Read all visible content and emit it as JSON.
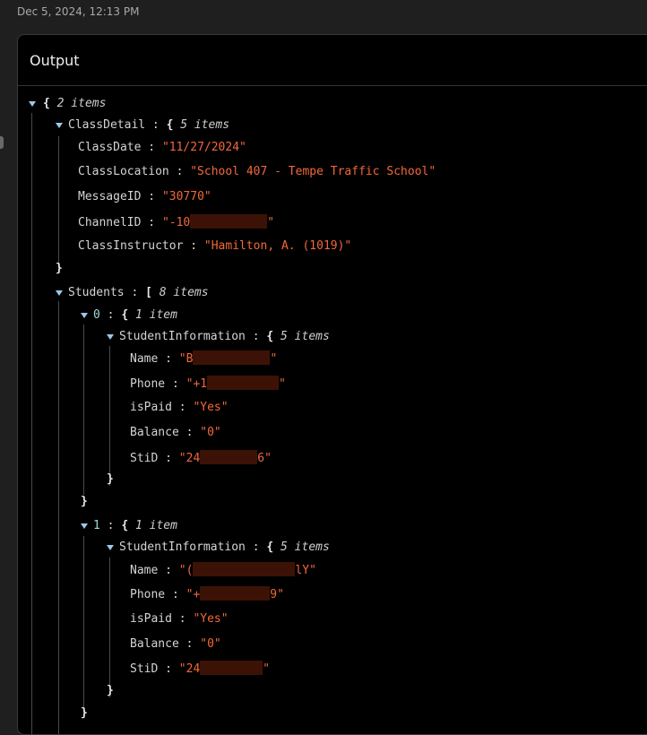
{
  "timestamp": "Dec 5, 2024, 12:13 PM",
  "panel": {
    "title": "Output"
  },
  "icons": {
    "expand": "caret-down-icon",
    "drag": "drag-handle-icon"
  },
  "colors": {
    "string": "#f2683a",
    "key": "#d4d4d4",
    "index": "#9fd8d8",
    "caret": "#9cc8e8",
    "background": "#000000"
  },
  "tree": {
    "root": {
      "open": "{",
      "meta": "2 items"
    },
    "class_detail": {
      "key": "ClassDetail",
      "open": "{",
      "meta": "5 items",
      "close": "}",
      "fields": {
        "class_date": {
          "key": "ClassDate",
          "value": "\"11/27/2024\""
        },
        "class_location": {
          "key": "ClassLocation",
          "value": "\"School 407 - Tempe Traffic School\""
        },
        "message_id": {
          "key": "MessageID",
          "value": "\"30770\""
        },
        "channel_id": {
          "key": "ChannelID",
          "value_start": "\"-10",
          "value_end": "\""
        },
        "class_instructor": {
          "key": "ClassInstructor",
          "value": "\"Hamilton, A. (1019)\""
        }
      }
    },
    "students": {
      "key": "Students",
      "open": "[",
      "meta": "8 items",
      "items": [
        {
          "index": "0",
          "open": "{",
          "meta": "1 item",
          "close": "}",
          "info": {
            "key": "StudentInformation",
            "open": "{",
            "meta": "5 items",
            "close": "}",
            "name": {
              "key": "Name",
              "value_start": "\"B",
              "value_end": "\""
            },
            "phone": {
              "key": "Phone",
              "value_start": "\"+1",
              "value_end": "\""
            },
            "is_paid": {
              "key": "isPaid",
              "value": "\"Yes\""
            },
            "balance": {
              "key": "Balance",
              "value": "\"0\""
            },
            "stid": {
              "key": "StiD",
              "value_start": "\"24",
              "value_end": "6\""
            }
          }
        },
        {
          "index": "1",
          "open": "{",
          "meta": "1 item",
          "close": "}",
          "info": {
            "key": "StudentInformation",
            "open": "{",
            "meta": "5 items",
            "close": "}",
            "name": {
              "key": "Name",
              "value_start": "\"(",
              "value_end": "lY\""
            },
            "phone": {
              "key": "Phone",
              "value_start": "\"+",
              "value_end": "9\""
            },
            "is_paid": {
              "key": "isPaid",
              "value": "\"Yes\""
            },
            "balance": {
              "key": "Balance",
              "value": "\"0\""
            },
            "stid": {
              "key": "StiD",
              "value_start": "\"24",
              "value_end": "\""
            }
          }
        }
      ]
    }
  }
}
